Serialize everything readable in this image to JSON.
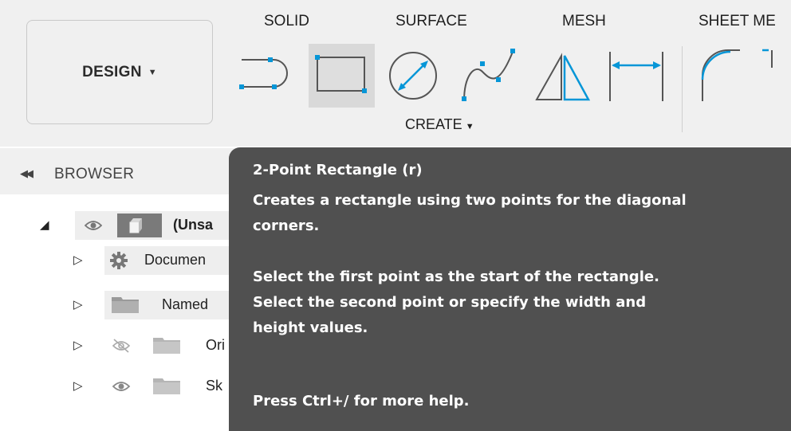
{
  "toolbar": {
    "workspace_label": "DESIGN",
    "tabs": [
      "SOLID",
      "SURFACE",
      "MESH",
      "SHEET ME"
    ],
    "create_label": "CREATE",
    "tools": [
      {
        "name": "center-slot-icon"
      },
      {
        "name": "2-point-rectangle-icon",
        "active": true
      },
      {
        "name": "center-diameter-circle-icon"
      },
      {
        "name": "spline-icon"
      },
      {
        "name": "mirror-icon"
      },
      {
        "name": "dimension-icon"
      },
      {
        "name": "fillet-icon"
      }
    ],
    "accent_color": "#0696d7"
  },
  "browser": {
    "title": "BROWSER",
    "items": [
      {
        "label": "(Unsa",
        "icon": "component-icon",
        "visibility": "visible",
        "expanded": true
      },
      {
        "label": "Documen",
        "icon": "gear-icon",
        "expanded": false
      },
      {
        "label": "Named",
        "icon": "folder-icon",
        "expanded": false
      },
      {
        "label": "Ori",
        "icon": "folder-icon",
        "visibility": "hidden",
        "expanded": false
      },
      {
        "label": "Sk",
        "icon": "folder-icon",
        "visibility": "visible",
        "expanded": false
      }
    ]
  },
  "tooltip": {
    "title": "2-Point Rectangle (r)",
    "line1": "Creates a rectangle using two points for the diagonal",
    "line2": "corners.",
    "line3": "Select the first point as the start of the rectangle.",
    "line4": "Select the second point or specify the width and",
    "line5": "height values.",
    "help": "Press Ctrl+/ for more help."
  }
}
